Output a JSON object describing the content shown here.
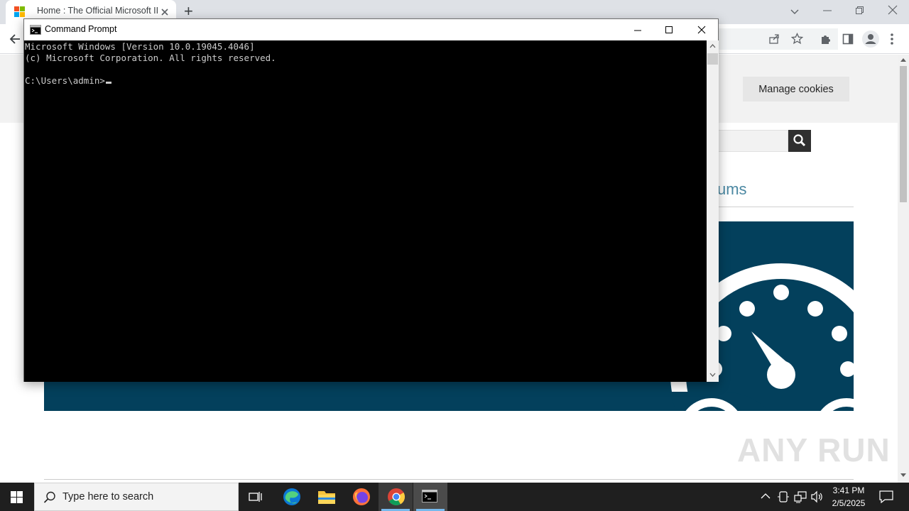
{
  "browser": {
    "tab_title": "Home : The Official Microsoft IIS",
    "new_tab_symbol": "+",
    "window_controls": [
      "minimize-icon",
      "restore-icon",
      "close-icon"
    ],
    "toolbar_icons": [
      "back-arrow-icon",
      "share-icon",
      "star-icon",
      "extensions-icon",
      "sidebar-icon",
      "profile-icon",
      "menu-icon"
    ]
  },
  "webpage": {
    "manage_cookies_label": "Manage cookies",
    "forums_partial_text": "ums",
    "accent_color": "#03405c",
    "link_color": "#4b88a2"
  },
  "cmd": {
    "title": "Command Prompt",
    "lines": [
      "Microsoft Windows [Version 10.0.19045.4046]",
      "(c) Microsoft Corporation. All rights reserved.",
      "",
      "C:\\Users\\admin>"
    ]
  },
  "taskbar": {
    "search_placeholder": "Type here to search",
    "apps": [
      "task-view-icon",
      "edge-icon",
      "file-explorer-icon",
      "firefox-icon",
      "chrome-icon",
      "cmd-icon"
    ],
    "time": "3:41 PM",
    "date": "2/5/2025"
  },
  "watermark": "ANY RUN"
}
